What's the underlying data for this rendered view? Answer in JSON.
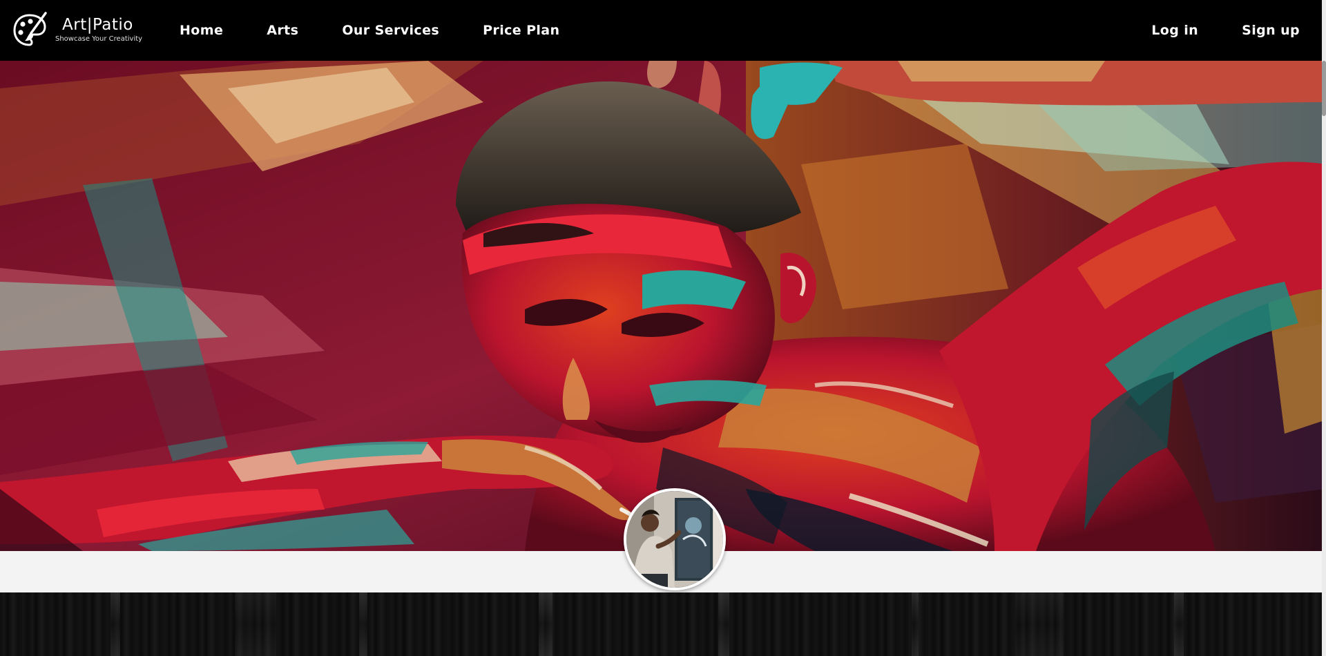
{
  "brand": {
    "name": "Art|Patio",
    "tagline": "Showcase Your Creativity",
    "icon": "palette-brush-icon"
  },
  "nav": {
    "items": [
      {
        "label": "Home"
      },
      {
        "label": "Arts"
      },
      {
        "label": "Our Services"
      },
      {
        "label": "Price Plan"
      }
    ]
  },
  "auth": {
    "login_label": "Log in",
    "signup_label": "Sign up"
  },
  "hero": {
    "image": "painted-face-hero-image",
    "colors": [
      "#8a0f2e",
      "#e8273a",
      "#2aa59a",
      "#c96f2e",
      "#d9b46a"
    ]
  },
  "profile": {
    "avatar": "artist-painting-avatar"
  },
  "colors": {
    "navbar_bg": "#000000",
    "page_bg": "#f3f3f3",
    "footer_bg": "#111111",
    "nav_text": "#ffffff"
  }
}
